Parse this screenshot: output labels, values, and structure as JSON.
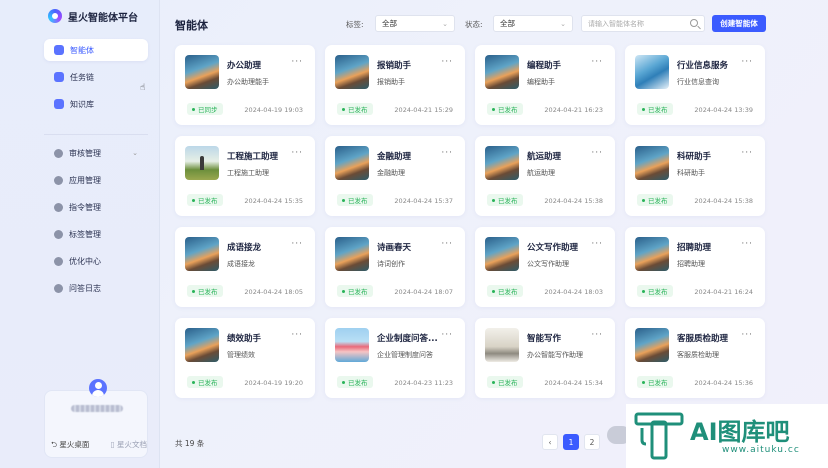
{
  "app": {
    "title": "星火智能体平台"
  },
  "sidebar": {
    "items": [
      {
        "label": "智能体",
        "active": true
      },
      {
        "label": "任务链"
      },
      {
        "label": "知识库"
      },
      {
        "label": "审核管理",
        "expandable": true
      },
      {
        "label": "应用管理"
      },
      {
        "label": "指令管理"
      },
      {
        "label": "标签管理"
      },
      {
        "label": "优化中心"
      },
      {
        "label": "问答日志"
      }
    ],
    "user": {
      "desktop_link": "星火桌面",
      "docs_link": "星火文档"
    }
  },
  "header": {
    "title": "智能体",
    "tag_label": "标签:",
    "tag_value": "全部",
    "status_label": "状态:",
    "status_value": "全部",
    "search_placeholder": "请输入智能体名称",
    "create_button": "创建智能体"
  },
  "cards": [
    {
      "title": "办公助理",
      "sub": "办公助理能手",
      "status": "已同步",
      "date": "2024-04-19 19:03",
      "thumb": "ocean"
    },
    {
      "title": "报销助手",
      "sub": "报销助手",
      "status": "已发布",
      "date": "2024-04-21 15:29",
      "thumb": "ocean"
    },
    {
      "title": "编程助手",
      "sub": "编程助手",
      "status": "已发布",
      "date": "2024-04-21 16:23",
      "thumb": "ocean"
    },
    {
      "title": "行业信息服务",
      "sub": "行业信息查询",
      "status": "已发布",
      "date": "2024-04-24 13:39",
      "thumb": "wave"
    },
    {
      "title": "工程施工助理",
      "sub": "工程施工助理",
      "status": "已发布",
      "date": "2024-04-24 15:35",
      "thumb": "field"
    },
    {
      "title": "金融助理",
      "sub": "金融助理",
      "status": "已发布",
      "date": "2024-04-24 15:37",
      "thumb": "ocean"
    },
    {
      "title": "航运助理",
      "sub": "航运助理",
      "status": "已发布",
      "date": "2024-04-24 15:38",
      "thumb": "ocean"
    },
    {
      "title": "科研助手",
      "sub": "科研助手",
      "status": "已发布",
      "date": "2024-04-24 15:38",
      "thumb": "ocean"
    },
    {
      "title": "成语接龙",
      "sub": "成语接龙",
      "status": "已发布",
      "date": "2024-04-24 18:05",
      "thumb": "ocean"
    },
    {
      "title": "诗画春天",
      "sub": "诗词创作",
      "status": "已发布",
      "date": "2024-04-24 18:07",
      "thumb": "ocean"
    },
    {
      "title": "公文写作助理",
      "sub": "公文写作助理",
      "status": "已发布",
      "date": "2024-04-24 18:03",
      "thumb": "ocean"
    },
    {
      "title": "招聘助理",
      "sub": "招聘助理",
      "status": "已发布",
      "date": "2024-04-21 16:24",
      "thumb": "ocean"
    },
    {
      "title": "绩效助手",
      "sub": "管理绩效",
      "status": "已发布",
      "date": "2024-04-19 19:20",
      "thumb": "ocean"
    },
    {
      "title": "企业制度问答...",
      "sub": "企业管理制度问答",
      "status": "已发布",
      "date": "2024-04-23 11:23",
      "thumb": "city"
    },
    {
      "title": "智能写作",
      "sub": "办公智能写作助理",
      "status": "已发布",
      "date": "2024-04-24 15:34",
      "thumb": "room"
    },
    {
      "title": "客服质检助理",
      "sub": "客服质检助理",
      "status": "已发布",
      "date": "2024-04-24 15:36",
      "thumb": "ocean"
    }
  ],
  "footer": {
    "total": "共 19 条",
    "pages": [
      "1",
      "2"
    ],
    "current_page": "1",
    "prev_icon": "‹"
  },
  "watermark": {
    "brand": "AI图库吧",
    "url": "www.aituku.cc"
  },
  "colors": {
    "accent": "#3b5bff",
    "published_green": "#2ab45a"
  }
}
